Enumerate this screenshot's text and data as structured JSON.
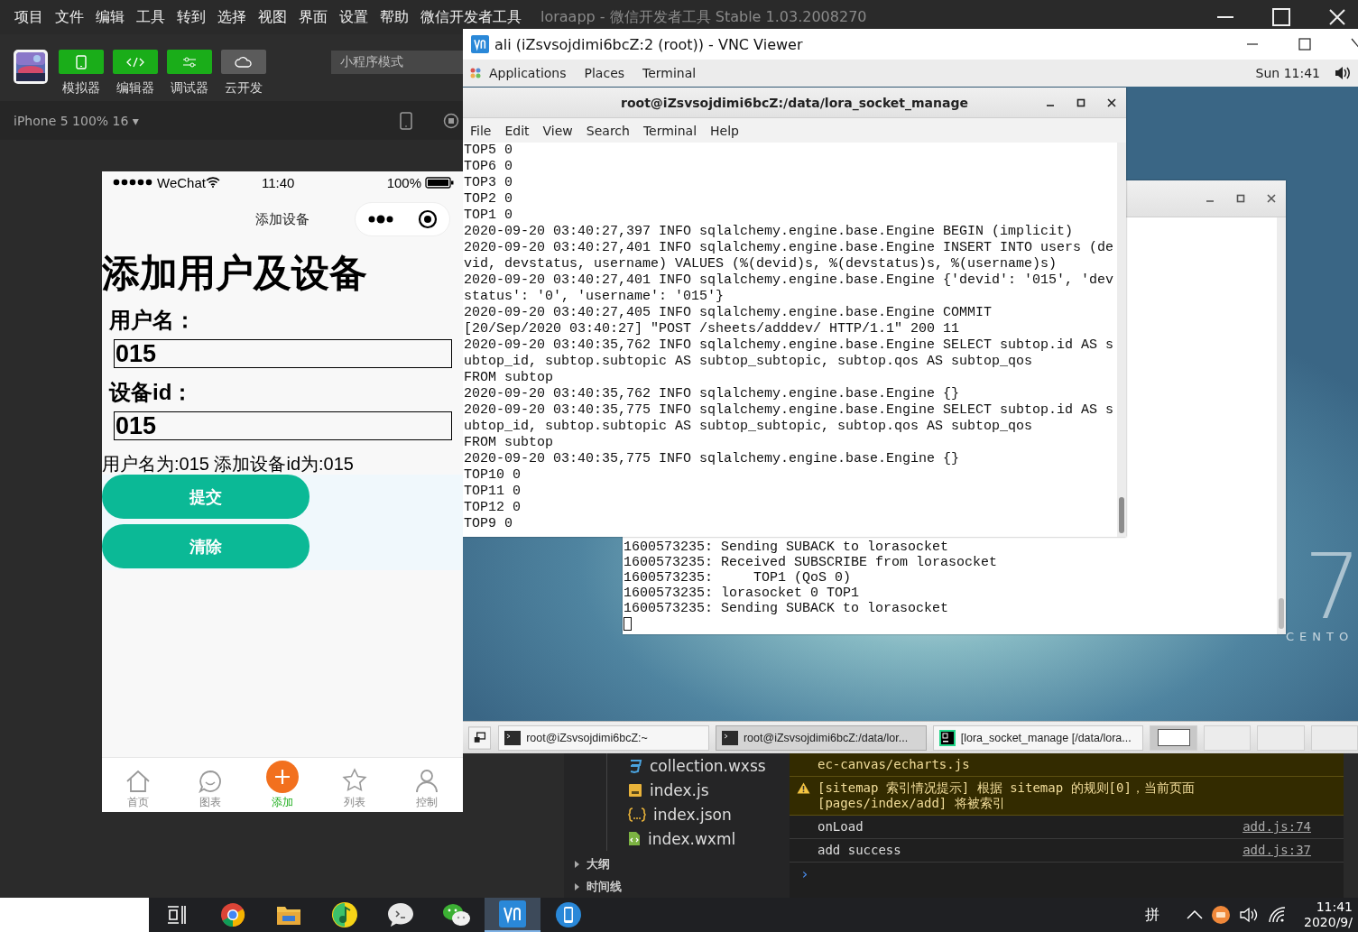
{
  "ide": {
    "menu": [
      "项目",
      "文件",
      "编辑",
      "工具",
      "转到",
      "选择",
      "视图",
      "界面",
      "设置",
      "帮助",
      "微信开发者工具"
    ],
    "title": "loraapp - 微信开发者工具 Stable 1.03.2008270",
    "toolbar": [
      {
        "label": "模拟器",
        "kind": "phone",
        "active": true
      },
      {
        "label": "编辑器",
        "kind": "code",
        "active": true
      },
      {
        "label": "调试器",
        "kind": "sliders",
        "active": true
      },
      {
        "label": "云开发",
        "kind": "cloud",
        "active": false
      }
    ],
    "mode": "小程序模式",
    "device": "iPhone 5 100% 16 ▾",
    "files": [
      {
        "name": "collection.wxss",
        "kind": "wxss"
      },
      {
        "name": "index.js",
        "kind": "js"
      },
      {
        "name": "index.json",
        "kind": "json"
      },
      {
        "name": "index.wxml",
        "kind": "wxml"
      }
    ],
    "sections": [
      {
        "label": "大纲",
        "expanded": false
      },
      {
        "label": "时间线",
        "expanded": false
      }
    ],
    "console": [
      {
        "kind": "warning-text",
        "lines": [
          "ec-canvas/echarts.js"
        ]
      },
      {
        "kind": "warning",
        "lines": [
          "[sitemap 索引情况提示] 根据 sitemap 的规则[0]，当前页面",
          "[pages/index/add] 将被索引"
        ]
      },
      {
        "kind": "log",
        "lines": [
          "onLoad"
        ],
        "source": "add.js:74"
      },
      {
        "kind": "log",
        "lines": [
          "add success"
        ],
        "source": "add.js:37"
      }
    ],
    "prompt": "›"
  },
  "simulator": {
    "status": {
      "carrier": "WeChat",
      "time": "11:40",
      "battery": "100%"
    },
    "nav_title": "添加设备",
    "heading": "添加用户及设备",
    "fields": [
      {
        "label": "用户名：",
        "value": "015"
      },
      {
        "label": "设备id：",
        "value": "015"
      }
    ],
    "result": "用户名为:015 添加设备id为:015",
    "buttons": [
      "提交",
      "清除"
    ],
    "tabs": [
      {
        "label": "首页",
        "kind": "home",
        "selected": false
      },
      {
        "label": "图表",
        "kind": "chat",
        "selected": false
      },
      {
        "label": "添加",
        "kind": "add",
        "selected": true
      },
      {
        "label": "列表",
        "kind": "star",
        "selected": false
      },
      {
        "label": "控制",
        "kind": "person",
        "selected": false
      }
    ]
  },
  "vnc": {
    "title": "ali (iZsvsojdimi6bcZ:2 (root)) - VNC Viewer",
    "top_bar": {
      "menus": [
        "Applications",
        "Places",
        "Terminal"
      ],
      "clock": "Sun 11:41"
    },
    "terminal_front": {
      "title": "root@iZsvsojdimi6bcZ:/data/lora_socket_manage",
      "menu": [
        "File",
        "Edit",
        "View",
        "Search",
        "Terminal",
        "Help"
      ],
      "lines": [
        "TOP5 0",
        "TOP6 0",
        "TOP3 0",
        "TOP2 0",
        "TOP1 0",
        "2020-09-20 03:40:27,397 INFO sqlalchemy.engine.base.Engine BEGIN (implicit)",
        "2020-09-20 03:40:27,401 INFO sqlalchemy.engine.base.Engine INSERT INTO users (de",
        "vid, devstatus, username) VALUES (%(devid)s, %(devstatus)s, %(username)s)",
        "2020-09-20 03:40:27,401 INFO sqlalchemy.engine.base.Engine {'devid': '015', 'dev",
        "status': '0', 'username': '015'}",
        "2020-09-20 03:40:27,405 INFO sqlalchemy.engine.base.Engine COMMIT",
        "[20/Sep/2020 03:40:27] \"POST /sheets/adddev/ HTTP/1.1\" 200 11",
        "2020-09-20 03:40:35,762 INFO sqlalchemy.engine.base.Engine SELECT subtop.id AS s",
        "ubtop_id, subtop.subtopic AS subtop_subtopic, subtop.qos AS subtop_qos",
        "FROM subtop",
        "2020-09-20 03:40:35,762 INFO sqlalchemy.engine.base.Engine {}",
        "2020-09-20 03:40:35,775 INFO sqlalchemy.engine.base.Engine SELECT subtop.id AS s",
        "ubtop_id, subtop.subtopic AS subtop_subtopic, subtop.qos AS subtop_qos",
        "FROM subtop",
        "2020-09-20 03:40:35,775 INFO sqlalchemy.engine.base.Engine {}",
        "TOP10 0",
        "TOP11 0",
        "TOP12 0",
        "TOP9 0"
      ]
    },
    "terminal_back": {
      "lines": [
        "1600573235: Sending SUBACK to lorasocket",
        "1600573235: Received SUBSCRIBE from lorasocket",
        "1600573235:     TOP1 (QoS 0)",
        "1600573235: lorasocket 0 TOP1",
        "1600573235: Sending SUBACK to lorasocket"
      ]
    },
    "brand": {
      "number": "7",
      "name": "CENTO"
    },
    "tasks": [
      {
        "label": "root@iZsvsojdimi6bcZ:~",
        "kind": "terminal",
        "selected": false
      },
      {
        "label": "root@iZsvsojdimi6bcZ:/data/lor...",
        "kind": "terminal",
        "selected": true
      },
      {
        "label": "[lora_socket_manage [/data/lora...",
        "kind": "pycharm",
        "selected": false
      }
    ],
    "workspaces": [
      {
        "selected": true
      },
      {
        "selected": false
      },
      {
        "selected": false
      },
      {
        "selected": false
      }
    ]
  },
  "taskbar": {
    "apps": [
      {
        "kind": "taskview",
        "selected": false
      },
      {
        "kind": "chrome",
        "selected": false
      },
      {
        "kind": "folder",
        "selected": false
      },
      {
        "kind": "music",
        "selected": false
      },
      {
        "kind": "chat",
        "selected": false
      },
      {
        "kind": "wechat",
        "selected": false
      },
      {
        "kind": "vnc",
        "selected": true
      },
      {
        "kind": "phone",
        "selected": false
      }
    ],
    "ime": "拼",
    "time": "11:41",
    "date": "2020/9/"
  }
}
